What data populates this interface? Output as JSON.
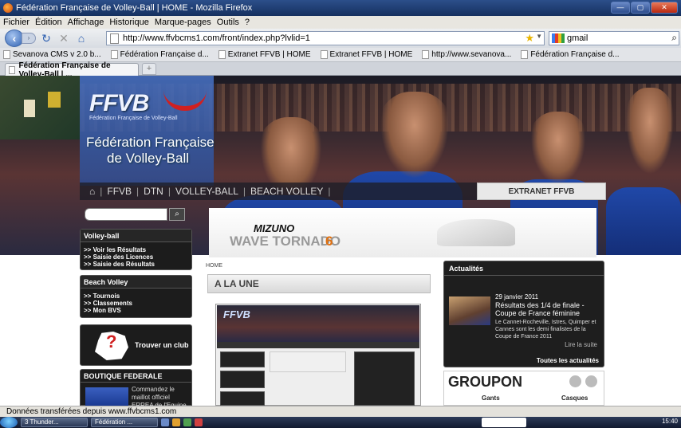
{
  "window": {
    "title": "Fédération Française de Volley-Ball | HOME - Mozilla Firefox"
  },
  "menu": [
    "Fichier",
    "Édition",
    "Affichage",
    "Historique",
    "Marque-pages",
    "Outils",
    "?"
  ],
  "navbar": {
    "url": "http://www.ffvbcms1.com/front/index.php?lvlid=1",
    "search_value": "gmail"
  },
  "bookmarks": [
    "Sevanova CMS v 2.0 b...",
    "Fédération Française d...",
    "Extranet FFVB | HOME",
    "Extranet FFVB | HOME",
    "http://www.sevanova...",
    "Fédération Française d..."
  ],
  "tab": {
    "label": "Fédération Française de Volley-Ball | ...",
    "new_tab_glyph": "+"
  },
  "site": {
    "logo": "FFVB",
    "logo_sub": "Fédération Française de Volley-Ball",
    "name_line1": "Fédération Française",
    "name_line2": "de Volley-Ball",
    "nav": [
      "FFVB",
      "DTN",
      "VOLLEY-BALL",
      "BEACH VOLLEY"
    ],
    "extranet": "EXTRANET FFVB"
  },
  "sidebar": {
    "volley": {
      "title": "Volley-ball",
      "items": [
        ">> Voir les Résultats",
        ">> Saisie des Licences",
        ">> Saisie des Résultats"
      ]
    },
    "beach": {
      "title": "Beach Volley",
      "items": [
        ">> Tournois",
        ">> Classements",
        ">> Mon BVS"
      ]
    },
    "club": {
      "label": "Trouver un club",
      "glyph": "?"
    },
    "boutique": {
      "title": "BOUTIQUE FEDERALE",
      "text": "Commandez le maillot officiel ERREA de l'Equipe de France"
    }
  },
  "ad": {
    "brand": "MIZUNO",
    "product": "WAVE TORNADO",
    "number": "6"
  },
  "main": {
    "breadcrumb": "HOME",
    "section_title": "A LA UNE",
    "thumb_logo": "FFVB"
  },
  "actualites": {
    "title": "Actualités",
    "date": "29 janvier 2011",
    "headline": "Résultats des 1/4 de finale - Coupe de France féminine",
    "desc": "Le Cannet-Rocheville, Istres, Quimper et Cannes sont les demi finalistes de la Coupe de France 2011",
    "read_more": "Lire la suite",
    "all": "Toutes les actualités"
  },
  "groupon": {
    "logo": "GROUPON",
    "items": [
      "Gants",
      "Casques"
    ]
  },
  "status": "Données transférées depuis www.ffvbcms1.com",
  "taskbar": {
    "tasks": [
      "3 Thunder...",
      "Fédération ..."
    ],
    "clock": "15:40"
  }
}
